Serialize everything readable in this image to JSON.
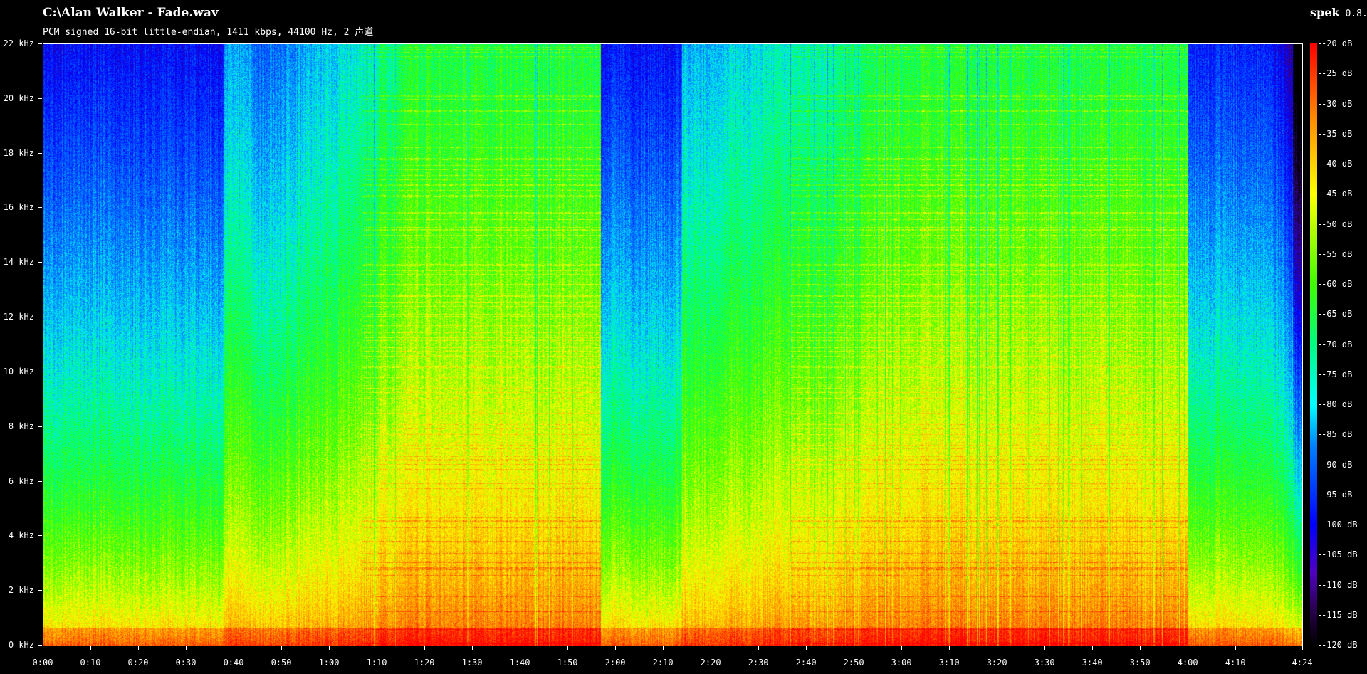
{
  "window": {
    "file_title": "C:\\Alan Walker - Fade.wav",
    "stream_info": "PCM signed 16-bit little-endian, 1411 kbps, 44100 Hz, 2 声道",
    "app_name": "spek",
    "app_version": "0.8."
  },
  "axes": {
    "frequency_labels": [
      "0 kHz",
      "2 kHz",
      "4 kHz",
      "6 kHz",
      "8 kHz",
      "10 kHz",
      "12 kHz",
      "14 kHz",
      "16 kHz",
      "18 kHz",
      "20 kHz",
      "22 kHz"
    ],
    "frequency_max_khz": 22,
    "time_labels": [
      "0:00",
      "0:10",
      "0:20",
      "0:30",
      "0:40",
      "0:50",
      "1:00",
      "1:10",
      "1:20",
      "1:30",
      "1:40",
      "1:50",
      "2:00",
      "2:10",
      "2:20",
      "2:30",
      "2:40",
      "2:50",
      "3:00",
      "3:10",
      "3:20",
      "3:30",
      "3:40",
      "3:50",
      "4:00",
      "4:10",
      "4:24"
    ],
    "time_seconds": [
      0,
      10,
      20,
      30,
      40,
      50,
      60,
      70,
      80,
      90,
      100,
      110,
      120,
      130,
      140,
      150,
      160,
      170,
      180,
      190,
      200,
      210,
      220,
      230,
      240,
      250,
      264
    ],
    "duration_seconds": 264,
    "db_labels": [
      "-20 dB",
      "-25 dB",
      "-30 dB",
      "-35 dB",
      "-40 dB",
      "-45 dB",
      "-50 dB",
      "-55 dB",
      "-60 dB",
      "-65 dB",
      "-70 dB",
      "-75 dB",
      "-80 dB",
      "-85 dB",
      "-90 dB",
      "-95 dB",
      "-100 dB",
      "-105 dB",
      "-110 dB",
      "-115 dB",
      "-120 dB"
    ],
    "db_range": [
      -120,
      -20
    ]
  }
}
